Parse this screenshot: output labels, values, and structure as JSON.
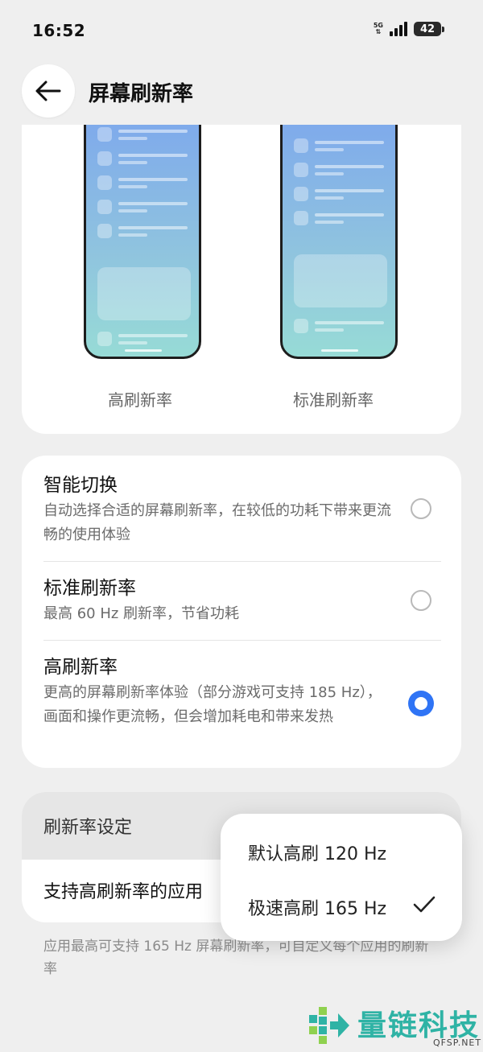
{
  "status_bar": {
    "time": "16:52",
    "network": "5G",
    "battery": "42"
  },
  "header": {
    "title": "屏幕刷新率"
  },
  "preview": {
    "left_label": "高刷新率",
    "right_label": "标准刷新率"
  },
  "options": [
    {
      "title": "智能切换",
      "desc": "自动选择合适的屏幕刷新率，在较低的功耗下带来更流畅的使用体验",
      "selected": false
    },
    {
      "title": "标准刷新率",
      "desc": "最高 60 Hz 刷新率，节省功耗",
      "selected": false
    },
    {
      "title": "高刷新率",
      "desc": "更高的屏幕刷新率体验（部分游戏可支持 185 Hz），画面和操作更流畅，但会增加耗电和带来发热",
      "selected": true
    }
  ],
  "settings": {
    "header": "刷新率设定",
    "row_label": "支持高刷新率的应用",
    "footnote": "应用最高可支持 165 Hz 屏幕刷新率，可自定义每个应用的刷新率"
  },
  "popup": {
    "items": [
      "默认高刷 120 Hz",
      "极速高刷 165 Hz"
    ],
    "selected": "极速高刷 165 Hz"
  },
  "watermark": {
    "brand": "量链科技",
    "site": "QFSP.NET"
  },
  "colors": {
    "accent": "#2f74f5",
    "background": "#efefef",
    "watermark": "#2fb3a5"
  }
}
